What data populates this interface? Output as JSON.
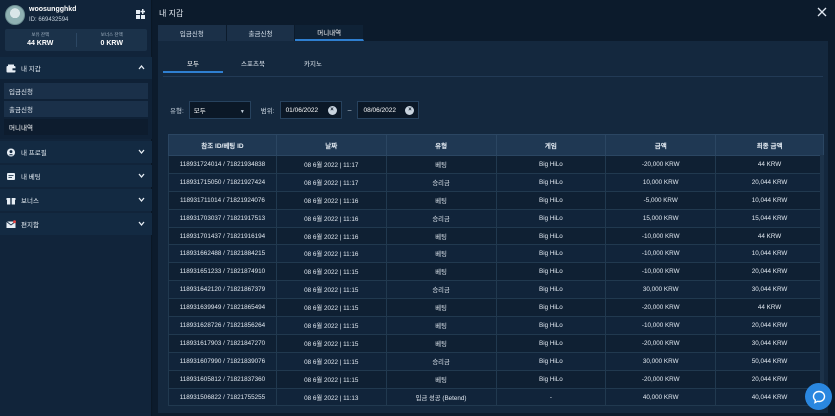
{
  "user": {
    "name": "woosungghkd",
    "id_text": "ID: 669432594"
  },
  "balances": {
    "main_label": "보유 잔액",
    "main_value": "44 KRW",
    "bonus_label": "보너스 잔액",
    "bonus_value": "0 KRW"
  },
  "sidebar": {
    "wallet_label": "내 지갑",
    "wallet_items": [
      "입금신청",
      "출금신청",
      "머니내역"
    ],
    "profile_label": "내 프로필",
    "betting_label": "내 베팅",
    "bonus_label": "보너스",
    "mailbox_label": "편지함"
  },
  "main": {
    "title": "내 지갑",
    "tabs": [
      "입금신청",
      "출금신청",
      "머니내역"
    ],
    "subtabs": [
      "모두",
      "스포츠북",
      "카지노"
    ]
  },
  "filters": {
    "type_label": "유형:",
    "type_value": "모두",
    "range_label": "범위:",
    "date_from": "01/06/2022",
    "date_to": "08/06/2022",
    "dash": "–"
  },
  "table": {
    "headers": [
      "참조 ID/베팅 ID",
      "날짜",
      "유형",
      "게임",
      "금액",
      "최종 금액"
    ],
    "rows": [
      [
        "118931724014 / 71821934838",
        "08 6월 2022 | 11:17",
        "베팅",
        "Big HiLo",
        "-20,000 KRW",
        "44 KRW"
      ],
      [
        "118931715050 / 71821927424",
        "08 6월 2022 | 11:17",
        "승리금",
        "Big HiLo",
        "10,000 KRW",
        "20,044 KRW"
      ],
      [
        "118931711014 / 71821924076",
        "08 6월 2022 | 11:16",
        "베팅",
        "Big HiLo",
        "-5,000 KRW",
        "10,044 KRW"
      ],
      [
        "118931703037 / 71821917513",
        "08 6월 2022 | 11:16",
        "승리금",
        "Big HiLo",
        "15,000 KRW",
        "15,044 KRW"
      ],
      [
        "118931701437 / 71821916194",
        "08 6월 2022 | 11:16",
        "베팅",
        "Big HiLo",
        "-10,000 KRW",
        "44 KRW"
      ],
      [
        "118931662488 / 71821884215",
        "08 6월 2022 | 11:16",
        "베팅",
        "Big HiLo",
        "-10,000 KRW",
        "10,044 KRW"
      ],
      [
        "118931651233 / 71821874910",
        "08 6월 2022 | 11:15",
        "베팅",
        "Big HiLo",
        "-10,000 KRW",
        "20,044 KRW"
      ],
      [
        "118931642120 / 71821867379",
        "08 6월 2022 | 11:15",
        "승리금",
        "Big HiLo",
        "30,000 KRW",
        "30,044 KRW"
      ],
      [
        "118931639949 / 71821865494",
        "08 6월 2022 | 11:15",
        "베팅",
        "Big HiLo",
        "-20,000 KRW",
        "44 KRW"
      ],
      [
        "118931628726 / 71821856264",
        "08 6월 2022 | 11:15",
        "베팅",
        "Big HiLo",
        "-10,000 KRW",
        "20,044 KRW"
      ],
      [
        "118931617903 / 71821847270",
        "08 6월 2022 | 11:15",
        "베팅",
        "Big HiLo",
        "-20,000 KRW",
        "30,044 KRW"
      ],
      [
        "118931607990 / 71821839076",
        "08 6월 2022 | 11:15",
        "승리금",
        "Big HiLo",
        "30,000 KRW",
        "50,044 KRW"
      ],
      [
        "118931605812 / 71821837360",
        "08 6월 2022 | 11:15",
        "베팅",
        "Big HiLo",
        "-20,000 KRW",
        "20,044 KRW"
      ],
      [
        "118931506822 / 71821755255",
        "08 6월 2022 | 11:13",
        "입금 성공 (Betend)",
        "-",
        "40,000 KRW",
        "40,044 KRW"
      ]
    ]
  },
  "icons": {
    "wallet": "wallet-icon",
    "profile": "user-circle-icon",
    "betting": "ticket-icon",
    "bonus": "gift-icon",
    "mail": "envelope-icon",
    "close": "close-icon",
    "chat": "chat-icon"
  },
  "colors": {
    "accent": "#2f7fd0",
    "chat": "#2a87e0"
  }
}
